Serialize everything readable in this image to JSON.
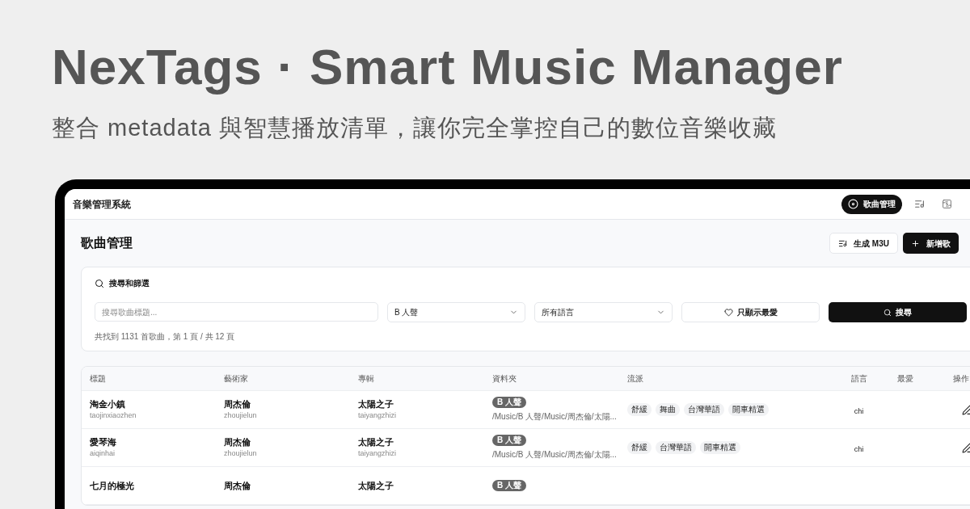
{
  "headline": {
    "title": "NexTags · Smart Music Manager",
    "subtitle": "整合 metadata 與智慧播放清單，讓你完全掌控自己的數位音樂收藏"
  },
  "app": {
    "title": "音樂管理系統",
    "nav": [
      {
        "kind": "disc",
        "label": "歌曲管理",
        "selected": true
      },
      {
        "kind": "playlist",
        "selected": false
      },
      {
        "kind": "bolt",
        "selected": false
      }
    ]
  },
  "page": {
    "title": "歌曲管理",
    "actions": [
      {
        "kind": "playlist",
        "label": "生成 M3U",
        "primary": false
      },
      {
        "kind": "plus",
        "label": "新增歌",
        "primary": true
      }
    ]
  },
  "filters": {
    "title": "搜尋和篩選",
    "search": {
      "placeholder": "搜尋歌曲標題..."
    },
    "folder_select": {
      "value": "B 人聲"
    },
    "language_select": {
      "value": "所有語言"
    },
    "favorites_toggle": {
      "label": "只顯示最愛",
      "on": false
    },
    "search_button": "搜尋",
    "result_summary": "共找到 1131 首歌曲，第 1 頁 / 共 12 頁"
  },
  "table": {
    "columns": [
      "標題",
      "藝術家",
      "專輯",
      "資料夾",
      "流派",
      "語言",
      "最愛",
      "操作"
    ],
    "rows": [
      {
        "title": "淘金小鎮",
        "title_roman": "taojinxiaozhen",
        "artist": "周杰倫",
        "artist_roman": "zhoujielun",
        "album": "太陽之子",
        "album_roman": "taiyangzhizi",
        "folder": "B 人聲",
        "path": "/Music/B 人聲/Music/周杰倫/太陽...",
        "genres": [
          "舒緩",
          "舞曲",
          "台灣華語",
          "開車精選"
        ],
        "language": "chi"
      },
      {
        "title": "愛琴海",
        "title_roman": "aiqinhai",
        "artist": "周杰倫",
        "artist_roman": "zhoujielun",
        "album": "太陽之子",
        "album_roman": "taiyangzhizi",
        "folder": "B 人聲",
        "path": "/Music/B 人聲/Music/周杰倫/太陽...",
        "genres": [
          "舒緩",
          "台灣華語",
          "開車精選"
        ],
        "language": "chi"
      },
      {
        "title": "七月的極光",
        "artist": "周杰倫",
        "album": "太陽之子",
        "folder": "B 人聲"
      }
    ]
  }
}
